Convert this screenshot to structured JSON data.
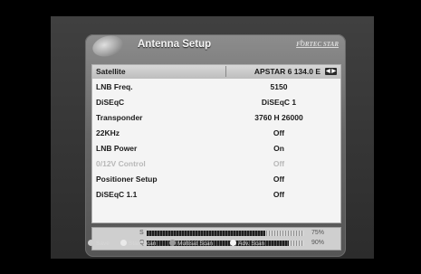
{
  "header": {
    "title": "Antenna Setup",
    "brand": "FORTEC STAR"
  },
  "settings": [
    {
      "label": "Satellite",
      "value": "APSTAR 6    134.0 E",
      "selected": true
    },
    {
      "label": "LNB Freq.",
      "value": "5150"
    },
    {
      "label": "DiSEqC",
      "value": "DiSEqC 1"
    },
    {
      "label": "Transponder",
      "value": "3760 H 26000"
    },
    {
      "label": "22KHz",
      "value": "Off"
    },
    {
      "label": "LNB Power",
      "value": "On"
    },
    {
      "label": "0/12V Control",
      "value": "Off",
      "disabled": true
    },
    {
      "label": "Positioner Setup",
      "value": "Off"
    },
    {
      "label": "DiSEqC 1.1",
      "value": "Off"
    }
  ],
  "signal": {
    "strength_label": "S",
    "strength_percent": 75,
    "strength_text": "75%",
    "quality_label": "Q",
    "quality_percent": 90,
    "quality_text": "90%"
  },
  "footer": [
    {
      "icon": "save-icon",
      "label": "Save"
    },
    {
      "icon": "start-scan-icon",
      "label": "Start Scan"
    },
    {
      "icon": "multisat-scan-icon",
      "label": "Multisat Scan"
    },
    {
      "icon": "adv-scan-icon",
      "label": "Adv. Scan"
    }
  ]
}
